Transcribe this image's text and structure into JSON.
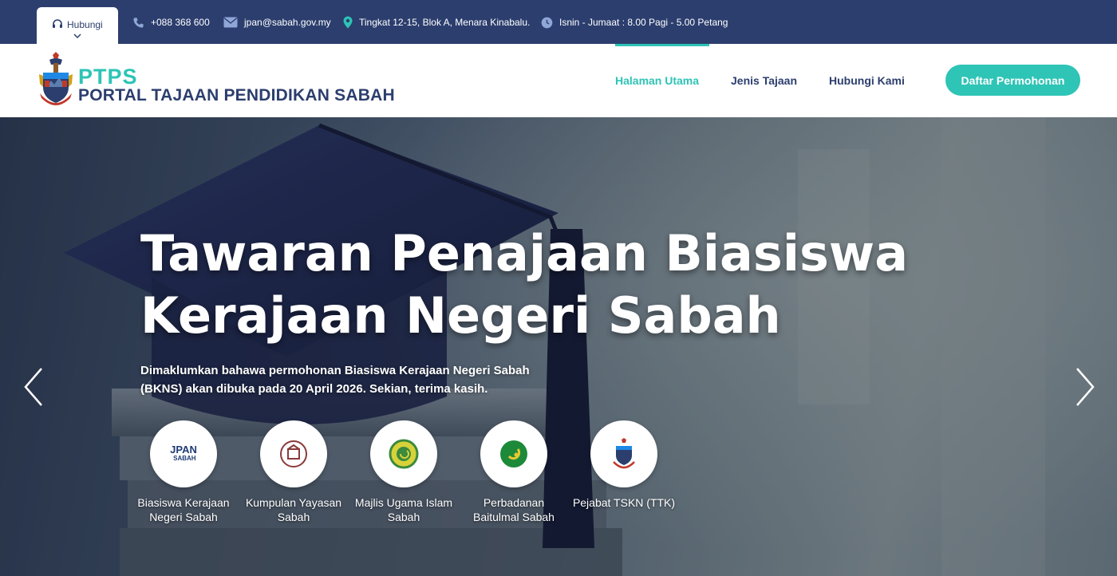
{
  "topbar": {
    "hubungi_label": "Hubungi",
    "phone": "+088 368 600",
    "email": "jpan@sabah.gov.my",
    "address": "Tingkat 12-15, Blok A, Menara Kinabalu.",
    "hours": "Isnin - Jumaat : 8.00 Pagi - 5.00 Petang",
    "icons": [
      "headset-icon",
      "chevron-down-icon",
      "phone-icon",
      "mail-icon",
      "location-pin-icon",
      "clock-icon"
    ]
  },
  "header": {
    "logo_short": "PTPS",
    "logo_full": "PORTAL TAJAAN PENDIDIKAN SABAH",
    "nav": [
      {
        "label": "Halaman Utama",
        "active": true
      },
      {
        "label": "Jenis Tajaan",
        "active": false
      },
      {
        "label": "Hubungi Kami",
        "active": false
      }
    ],
    "cta_label": "Daftar Permohonan"
  },
  "hero": {
    "title_line1": "Tawaran Penajaan Biasiswa",
    "title_line2": "Kerajaan Negeri Sabah",
    "description": "Dimaklumkan bahawa permohonan Biasiswa Kerajaan Negeri Sabah (BKNS) akan dibuka pada 20 April 2026. Sekian, terima kasih.",
    "agencies": [
      {
        "name": "Biasiswa Kerajaan Negeri Sabah",
        "logo_text": "JPAN",
        "logo_sub": "SABAH"
      },
      {
        "name": "Kumpulan Yayasan Sabah"
      },
      {
        "name": "Majlis Ugama Islam Sabah"
      },
      {
        "name": "Perbadanan Baitulmal Sabah"
      },
      {
        "name": "Pejabat TSKN (TTK)"
      }
    ]
  },
  "colors": {
    "navy": "#2c3e6e",
    "teal": "#2ec4b6",
    "white": "#ffffff"
  }
}
